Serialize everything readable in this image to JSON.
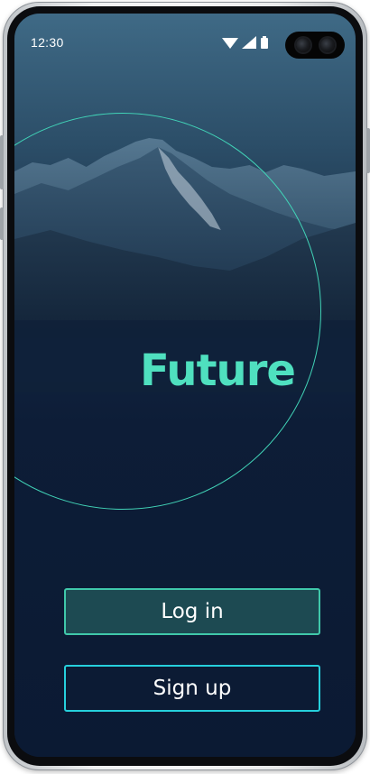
{
  "status_bar": {
    "time": "12:30",
    "icons": [
      "wifi-icon",
      "signal-icon",
      "battery-icon"
    ]
  },
  "brand": {
    "title": "Future",
    "accent_color": "#4fe0bf",
    "circle_color": "#41d3b7"
  },
  "actions": {
    "login_label": "Log in",
    "signup_label": "Sign up",
    "login_border_color": "#40c8aa",
    "signup_border_color": "#26d0dc"
  },
  "theme": {
    "background_color": "#0c1b34"
  }
}
